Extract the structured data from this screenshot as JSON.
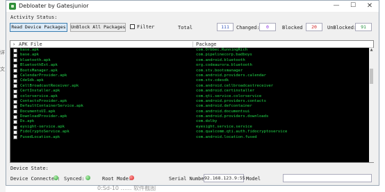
{
  "window": {
    "title": "Debloater by Gatesjunior"
  },
  "controls": {
    "activity_label": "Activity Status:",
    "read_button": "Read Device Packages",
    "unblock_all_button": "UnBlock All Packages",
    "filter_label": "Filter"
  },
  "stats": {
    "total_label": "Total",
    "total_value": "111",
    "changed_label": "Changed:",
    "changed_value": "0",
    "blocked_label": "Blocked",
    "blocked_value": "20",
    "unblocked_label": "UnBlocked:",
    "unblocked_value": "91"
  },
  "colors": {
    "total": "#3355bb",
    "changed": "#8a2be2",
    "blocked": "#d02020",
    "unblocked": "#1f8f3a",
    "list_text": "#21d94a",
    "list_bg": "#000000"
  },
  "list": {
    "col_apk": "APK File",
    "col_package": "Package",
    "rows": [
      {
        "apk": "base.apk",
        "pkg": "com.Orbbec.RunningRich"
      },
      {
        "apk": "base.apk",
        "pkg": "com.pipelinecorp.badboys"
      },
      {
        "apk": "bluetooth.apk",
        "pkg": "com.android.bluetooth"
      },
      {
        "apk": "BluetoothExt.apk",
        "pkg": "org.codeaurora.bluetooth"
      },
      {
        "apk": "BootsManager.apk",
        "pkg": "com.stv.bootsmanager"
      },
      {
        "apk": "CalendarProvider.apk",
        "pkg": "com.android.providers.calendar"
      },
      {
        "apk": "CdeSdk.apk",
        "pkg": "com.stv.cdesdk"
      },
      {
        "apk": "CellBroadcastReceiver.apk",
        "pkg": "com.android.cellbroadcastreceiver"
      },
      {
        "apk": "CertInstaller.apk",
        "pkg": "com.android.certinstaller"
      },
      {
        "apk": "colorservice.apk",
        "pkg": "com.qti.service.colorservice"
      },
      {
        "apk": "ContactsProvider.apk",
        "pkg": "com.android.providers.contacts"
      },
      {
        "apk": "DefaultContainerService.apk",
        "pkg": "com.android.defcontainer"
      },
      {
        "apk": "DocumentsUI.apk",
        "pkg": "com.android.documentsui"
      },
      {
        "apk": "DownloadProvider.apk",
        "pkg": "com.android.providers.downloads"
      },
      {
        "apk": "Ds.apk",
        "pkg": "com.dolby"
      },
      {
        "apk": "eysight-service.apk",
        "pkg": "eyesight.service.service"
      },
      {
        "apk": "FidoCryptoService.apk",
        "pkg": "com.qualcomm.qti.auth.fidocryptoservice"
      },
      {
        "apk": "FusedLocation.apk",
        "pkg": "com.android.location.fused"
      }
    ]
  },
  "device": {
    "state_label": "Device State:",
    "connected_label": "Device Connected:",
    "synced_label": "Synced:",
    "root_label": "Root Mode:",
    "serial_label": "Serial Number",
    "serial_value": "92.168.123.9:55",
    "model_label": "Model"
  },
  "background": {
    "bottom_text": "0:Sd-10 …… 软件截图"
  }
}
